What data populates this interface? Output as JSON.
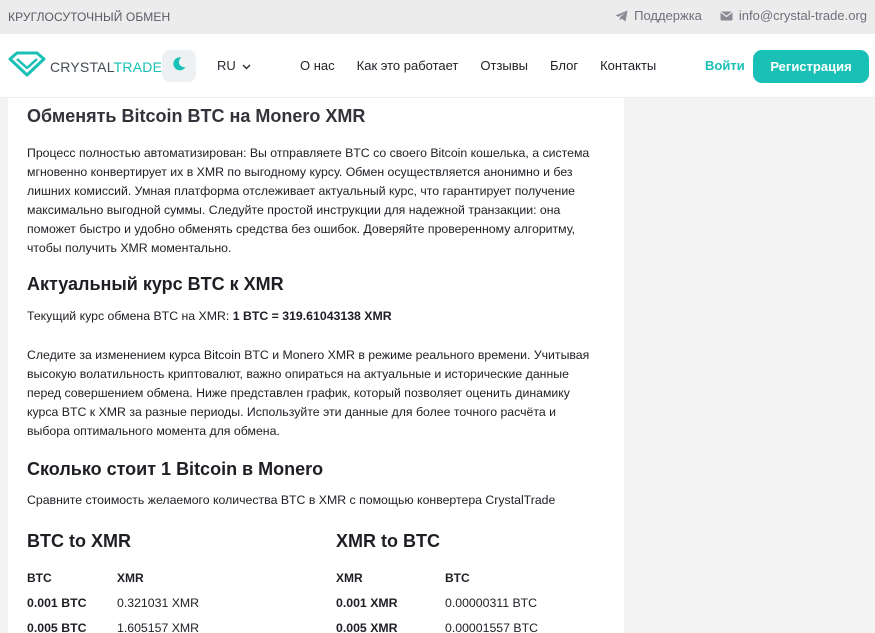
{
  "topbar": {
    "left_text": "КРУГЛОСУТОЧНЫЙ ОБМЕН",
    "support_label": "Поддержка",
    "email": "info@crystal-trade.org"
  },
  "nav": {
    "logo_part1": "CRYSTAL",
    "logo_part2": "TRADE",
    "language": "RU",
    "menu": [
      "О нас",
      "Как это работает",
      "Отзывы",
      "Блог",
      "Контакты"
    ],
    "login_label": "Войти",
    "register_label": "Регистрация",
    "accent_color": "#19c0b5"
  },
  "main": {
    "title": "Обменять Bitcoin BTC на Monero XMR",
    "intro": "Процесс полностью автоматизирован: Вы отправляете BTC со своего Bitcoin кошелька, а система мгновенно конвертирует их в XMR по выгодному курсу. Обмен осуществляется анонимно и без лишних комиссий. Умная платформа отслеживает актуальный курс, что гарантирует получение максимально выгодной суммы. Следуйте простой инструкции для надежной транзакции: она поможет быстро и удобно обменять средства без ошибок. Доверяйте проверенному алгоритму, чтобы получить XMR моментально.",
    "rate_heading": "Актуальный курс BTC к XMR",
    "rate_prefix": "Текущий курс обмена BTC на XMR: ",
    "rate_value": "1 BTC = 319.61043138 XMR",
    "rate_text": "Следите за изменением курса Bitcoin BTC и Monero XMR в режиме реального времени. Учитывая высокую волатильность криптовалют, важно опираться на актуальные и исторические данные перед совершением обмена. Ниже представлен график, который позволяет оценить динамику курса BTC к XMR за разные периоды. Используйте эти данные для более точного расчёта и выбора оптимального момента для обмена.",
    "price_heading": "Сколько стоит 1 Bitcoin в Monero",
    "price_text": "Сравните стоимость желаемого количества BTC в XMR с помощью конвертера CrystalTrade"
  },
  "converter": {
    "left": {
      "title": "BTC to XMR",
      "col1": "BTC",
      "col2": "XMR",
      "rows": [
        {
          "a": "0.001 BTC",
          "b": "0.321031 XMR"
        },
        {
          "a": "0.005 BTC",
          "b": "1.605157 XMR"
        }
      ]
    },
    "right": {
      "title": "XMR to BTC",
      "col1": "XMR",
      "col2": "BTC",
      "rows": [
        {
          "a": "0.001 XMR",
          "b": "0.00000311 BTC"
        },
        {
          "a": "0.005 XMR",
          "b": "0.00001557 BTC"
        }
      ]
    }
  }
}
